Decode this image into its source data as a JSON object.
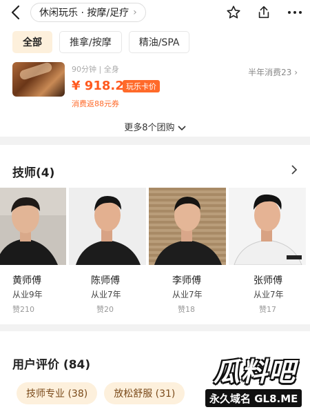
{
  "header": {
    "back_icon": "back-arrow-icon",
    "category": "休闲玩乐 · 按摩/足疗",
    "icons": [
      "star-icon",
      "share-icon",
      "more-icon"
    ]
  },
  "filters": {
    "tabs": [
      {
        "label": "全部",
        "active": true
      },
      {
        "label": "推拿/按摩",
        "active": false
      },
      {
        "label": "精油/SPA",
        "active": false
      }
    ]
  },
  "deal": {
    "meta": "90分钟 | 全身",
    "price": "¥ 918.2",
    "badge": "玩乐卡价",
    "rebate": "消费返88元券",
    "sold": "半年消费23",
    "more": "更多8个团购"
  },
  "technicians": {
    "title": "技师(4)",
    "items": [
      {
        "name": "黄师傅",
        "years": "从业9年",
        "likes": "赞210"
      },
      {
        "name": "陈师傅",
        "years": "从业7年",
        "likes": "赞20"
      },
      {
        "name": "李师傅",
        "years": "从业7年",
        "likes": "赞18"
      },
      {
        "name": "张师傅",
        "years": "从业7年",
        "likes": "赞17"
      }
    ]
  },
  "reviews": {
    "title": "用户评价 (84)",
    "tags": [
      {
        "label": "技师专业 (38)"
      },
      {
        "label": "放松舒服 (31)"
      }
    ]
  },
  "watermark": {
    "logo": "瓜料吧",
    "sub": "永久域名 GL8.ME"
  },
  "colors": {
    "accent": "#ff5a1f",
    "tag_bg": "#fdf0dc",
    "background": "#f2f2f2"
  }
}
